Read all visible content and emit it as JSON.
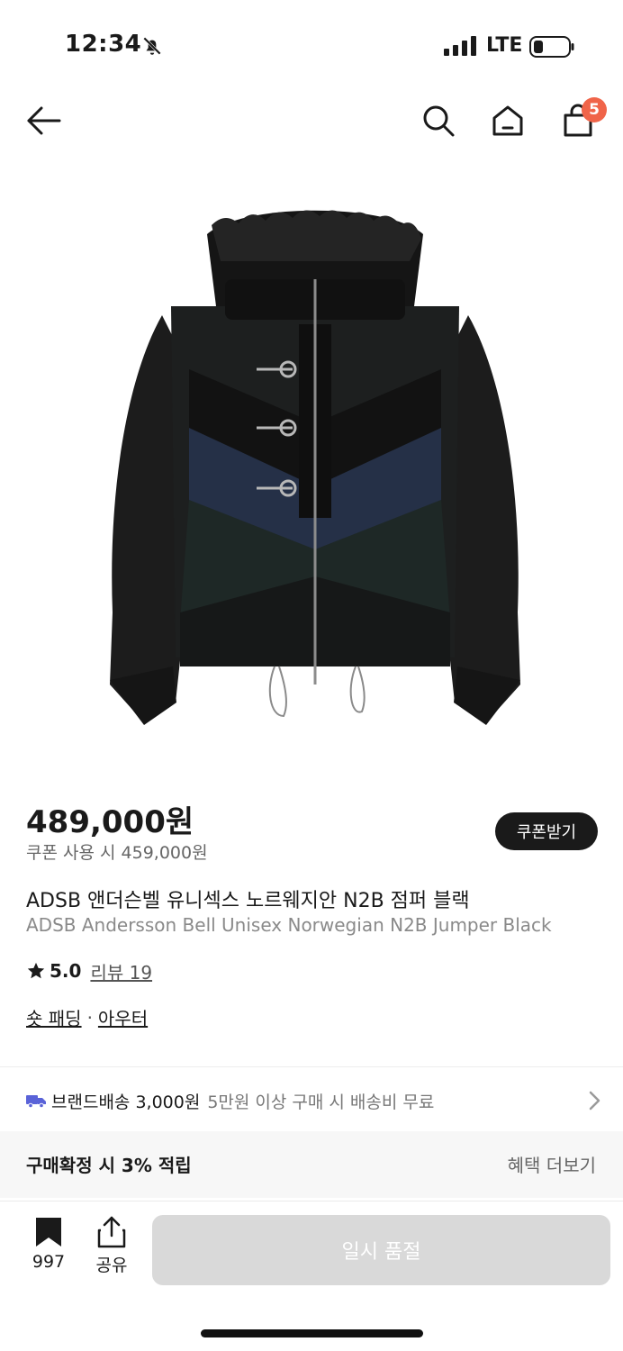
{
  "status_bar": {
    "time": "12:34",
    "network": "LTE"
  },
  "header": {
    "cart_count": "5"
  },
  "product": {
    "price": "489,000원",
    "coupon_price": "쿠폰 사용 시 459,000원",
    "coupon_button": "쿠폰받기",
    "title_ko": "ADSB 앤더슨벨 유니섹스 노르웨지안 N2B 점퍼 블랙",
    "title_en": "ADSB Andersson Bell Unisex Norwegian N2B Jumper Black",
    "rating": "5.0",
    "review_label": "리뷰 19",
    "categories": [
      "숏 패딩",
      "아우터"
    ],
    "category_separator": "·"
  },
  "shipping": {
    "label": "브랜드배송 3,000원",
    "note": "5만원 이상 구매 시 배송비 무료"
  },
  "benefit": {
    "title": "구매확정 시 3% 적립",
    "more": "혜택 더보기"
  },
  "bottom_bar": {
    "bookmark_count": "997",
    "share_label": "공유",
    "primary_button": "일시 품절"
  },
  "colors": {
    "badge": "#f06449",
    "shipping_truck": "#5a63d8",
    "disabled_button": "#d9d9d9"
  },
  "icons": [
    "bell-off-icon",
    "signal-icon",
    "battery-icon",
    "back-arrow-icon",
    "search-icon",
    "home-icon",
    "shopping-bag-icon",
    "star-icon",
    "truck-icon",
    "chevron-right-icon",
    "bookmark-icon",
    "share-icon"
  ]
}
